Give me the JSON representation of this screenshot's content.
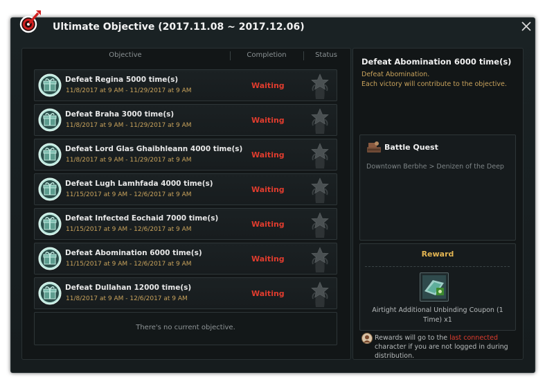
{
  "window": {
    "title": "Ultimate Objective (2017.11.08 ~ 2017.12.06)"
  },
  "columns": {
    "objective": "Objective",
    "completion": "Completion",
    "status": "Status"
  },
  "objectives": [
    {
      "name": "Defeat Regina 5000 time(s)",
      "dates": "11/8/2017 at 9 AM - 11/29/2017 at 9 AM",
      "completion": "Waiting"
    },
    {
      "name": "Defeat Braha 3000 time(s)",
      "dates": "11/8/2017 at 9 AM - 11/29/2017 at 9 AM",
      "completion": "Waiting"
    },
    {
      "name": "Defeat Lord Glas Ghaibhleann 4000 time(s)",
      "dates": "11/8/2017 at 9 AM - 11/29/2017 at 9 AM",
      "completion": "Waiting"
    },
    {
      "name": "Defeat Lugh Lamhfada 4000 time(s)",
      "dates": "11/15/2017 at 9 AM - 12/6/2017 at 9 AM",
      "completion": "Waiting"
    },
    {
      "name": "Defeat Infected Eochaid 7000 time(s)",
      "dates": "11/15/2017 at 9 AM - 12/6/2017 at 9 AM",
      "completion": "Waiting"
    },
    {
      "name": "Defeat Abomination 6000 time(s)",
      "dates": "11/15/2017 at 9 AM - 12/6/2017 at 9 AM",
      "completion": "Waiting"
    },
    {
      "name": "Defeat Dullahan 12000 time(s)",
      "dates": "11/8/2017 at 9 AM - 12/6/2017 at 9 AM",
      "completion": "Waiting"
    }
  ],
  "empty_message": "There's no current objective.",
  "detail": {
    "title": "Defeat Abomination 6000 time(s)",
    "desc_line1": "Defeat Abomination.",
    "desc_line2": "Each victory will contribute to the objective."
  },
  "quest": {
    "title": "Battle Quest",
    "location": "Downtown Berbhe > Denizen of the Deep"
  },
  "reward": {
    "title": "Reward",
    "item_line1": "Airtight Additional Unbinding Coupon (1",
    "item_line2": "Time) x1"
  },
  "note": {
    "part1": "Rewards will go to the ",
    "highlight": "last connected",
    "part2": " character if you are not logged in during distribution."
  },
  "colors": {
    "waiting": "#e03c2e",
    "date": "#c9a35c",
    "reward_title": "#e3b552"
  }
}
